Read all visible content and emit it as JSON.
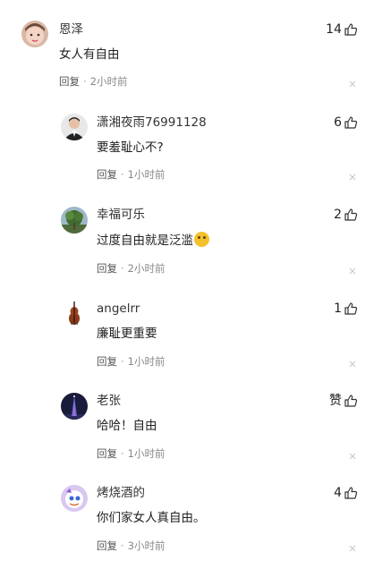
{
  "comments": [
    {
      "user": "恩泽",
      "text": "女人有自由",
      "reply_label": "回复",
      "time": "2小时前",
      "likes": "14",
      "avatar": "baby-avatar"
    },
    {
      "user": "潇湘夜雨76991128",
      "text": "要羞耻心不?",
      "reply_label": "回复",
      "time": "1小时前",
      "likes": "6",
      "avatar": "man-avatar"
    },
    {
      "user": "幸福可乐",
      "text": "过度自由就是泛滥",
      "reply_label": "回复",
      "time": "2小时前",
      "likes": "2",
      "avatar": "tree-avatar",
      "emoji": "smirk-emoji"
    },
    {
      "user": "angelrr",
      "text": "廉耻更重要",
      "reply_label": "回复",
      "time": "1小时前",
      "likes": "1",
      "avatar": "violin-avatar"
    },
    {
      "user": "老张",
      "text": "哈哈！自由",
      "reply_label": "回复",
      "time": "1小时前",
      "likes": "赞",
      "avatar": "tower-avatar"
    },
    {
      "user": "烤烧酒的",
      "text": "你们家女人真自由。",
      "reply_label": "回复",
      "time": "3小时前",
      "likes": "4",
      "avatar": "cartoon-avatar"
    }
  ],
  "colors": {
    "text": "#222222",
    "meta": "#888888",
    "background": "#ffffff"
  }
}
